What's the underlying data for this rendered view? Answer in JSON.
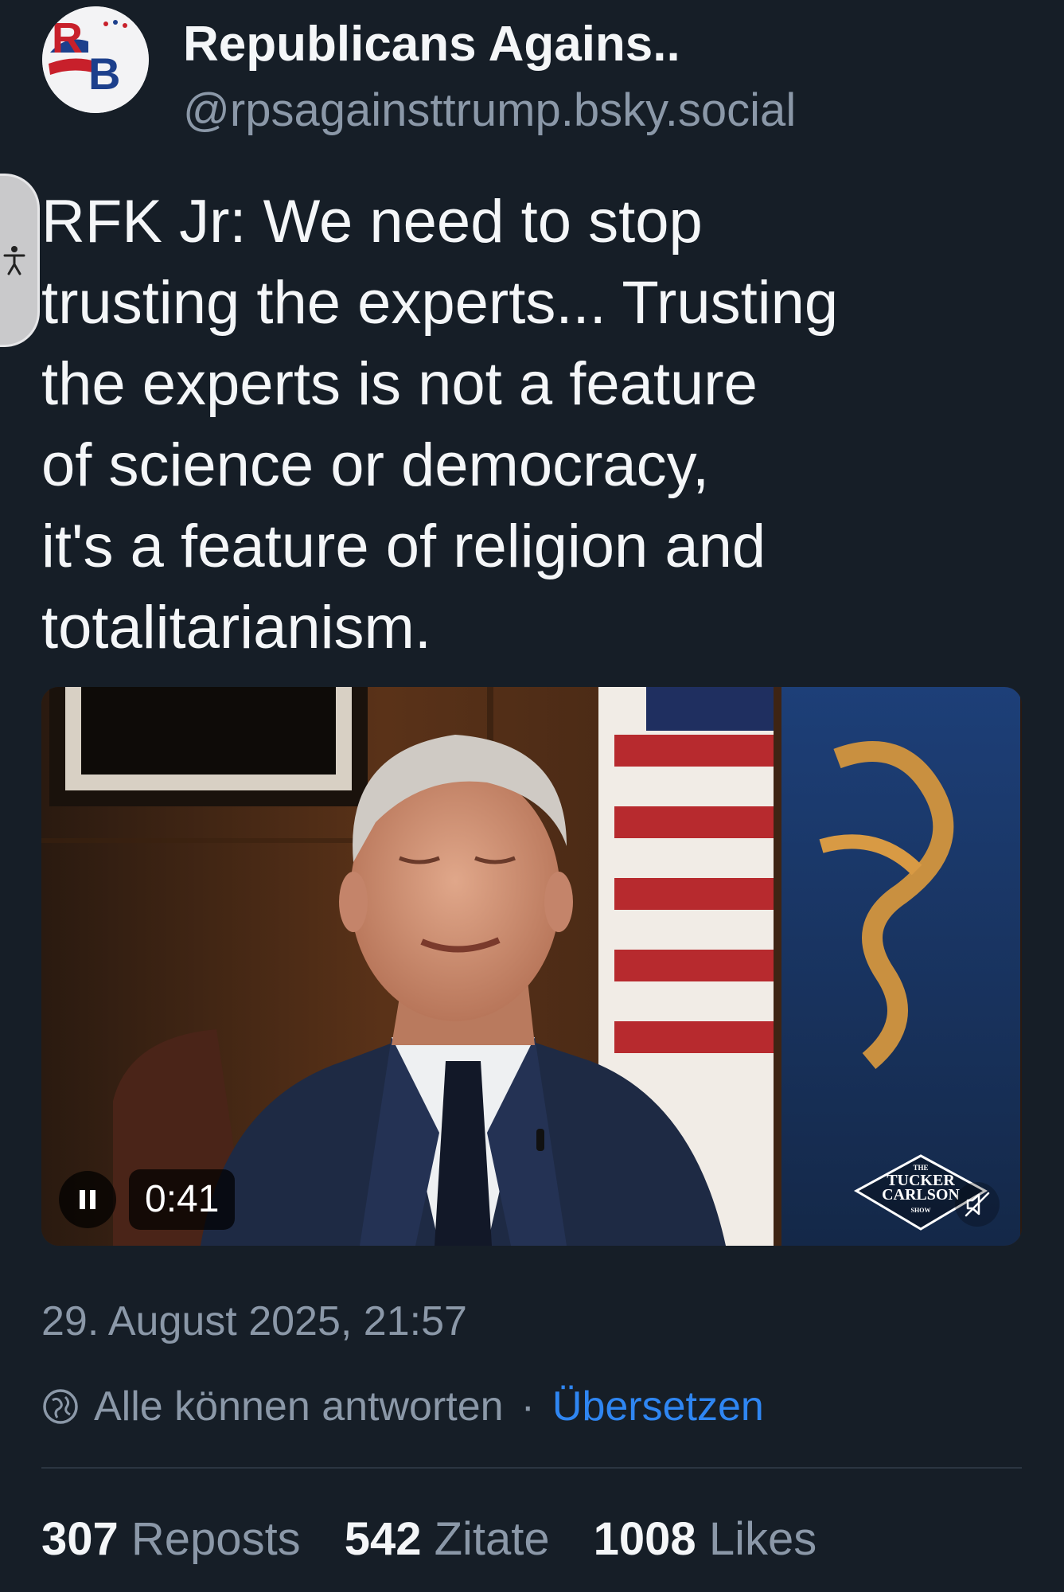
{
  "author": {
    "name": "Republicans Agains..",
    "handle": "@rpsagainsttrump.bsky.social",
    "avatar_letters": "RB"
  },
  "post": {
    "text": "RFK Jr: We need to stop\ntrusting the experts... Trusting\nthe experts is not a feature\nof science or democracy,\nit's a feature of religion and\ntotalitarianism."
  },
  "video": {
    "elapsed": "0:41",
    "state": "playing",
    "muted": true,
    "watermark": {
      "line1": "THE",
      "line2": "TUCKER",
      "line3": "CARLSON",
      "line4": "SHOW"
    }
  },
  "meta": {
    "timestamp": "29. August 2025, 21:57",
    "reply_permission": "Alle können antworten",
    "separator": "·",
    "translate_label": "Übersetzen"
  },
  "stats": [
    {
      "count": "307",
      "label": "Reposts"
    },
    {
      "count": "542",
      "label": "Zitate"
    },
    {
      "count": "1008",
      "label": "Likes"
    }
  ],
  "colors": {
    "background": "#161e27",
    "text_primary": "#f4f6f8",
    "text_secondary": "#8b98a8",
    "link": "#2f86f2"
  },
  "icons": [
    "accessibility-icon",
    "pause-icon",
    "muted-speaker-icon",
    "globe-icon"
  ]
}
